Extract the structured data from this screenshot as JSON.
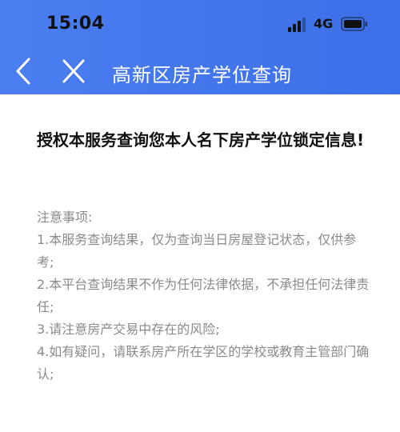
{
  "status_bar": {
    "time": "15:04",
    "network": "4G",
    "icons": [
      "signal-icon",
      "battery-icon"
    ]
  },
  "nav": {
    "title": "高新区房产学位查询",
    "back_icon": "chevron-left-icon",
    "close_icon": "close-icon"
  },
  "content": {
    "auth_title": "授权本服务查询您本人名下房产学位锁定信息!",
    "notice_heading": "注意事项:",
    "notice_items": [
      "1.本服务查询结果，仅为查询当日房屋登记状态，仅供参考;",
      "2.本平台查询结果不作为任何法律依据，不承担任何法律责任;",
      "3.请注意房产交易中存在的风险;",
      "4.如有疑问，请联系房产所在学区的学校或教育主管部门确认;"
    ]
  },
  "colors": {
    "header": "#3d6fe8",
    "title_text": "#111111",
    "notice_text": "#8a8a8a"
  }
}
